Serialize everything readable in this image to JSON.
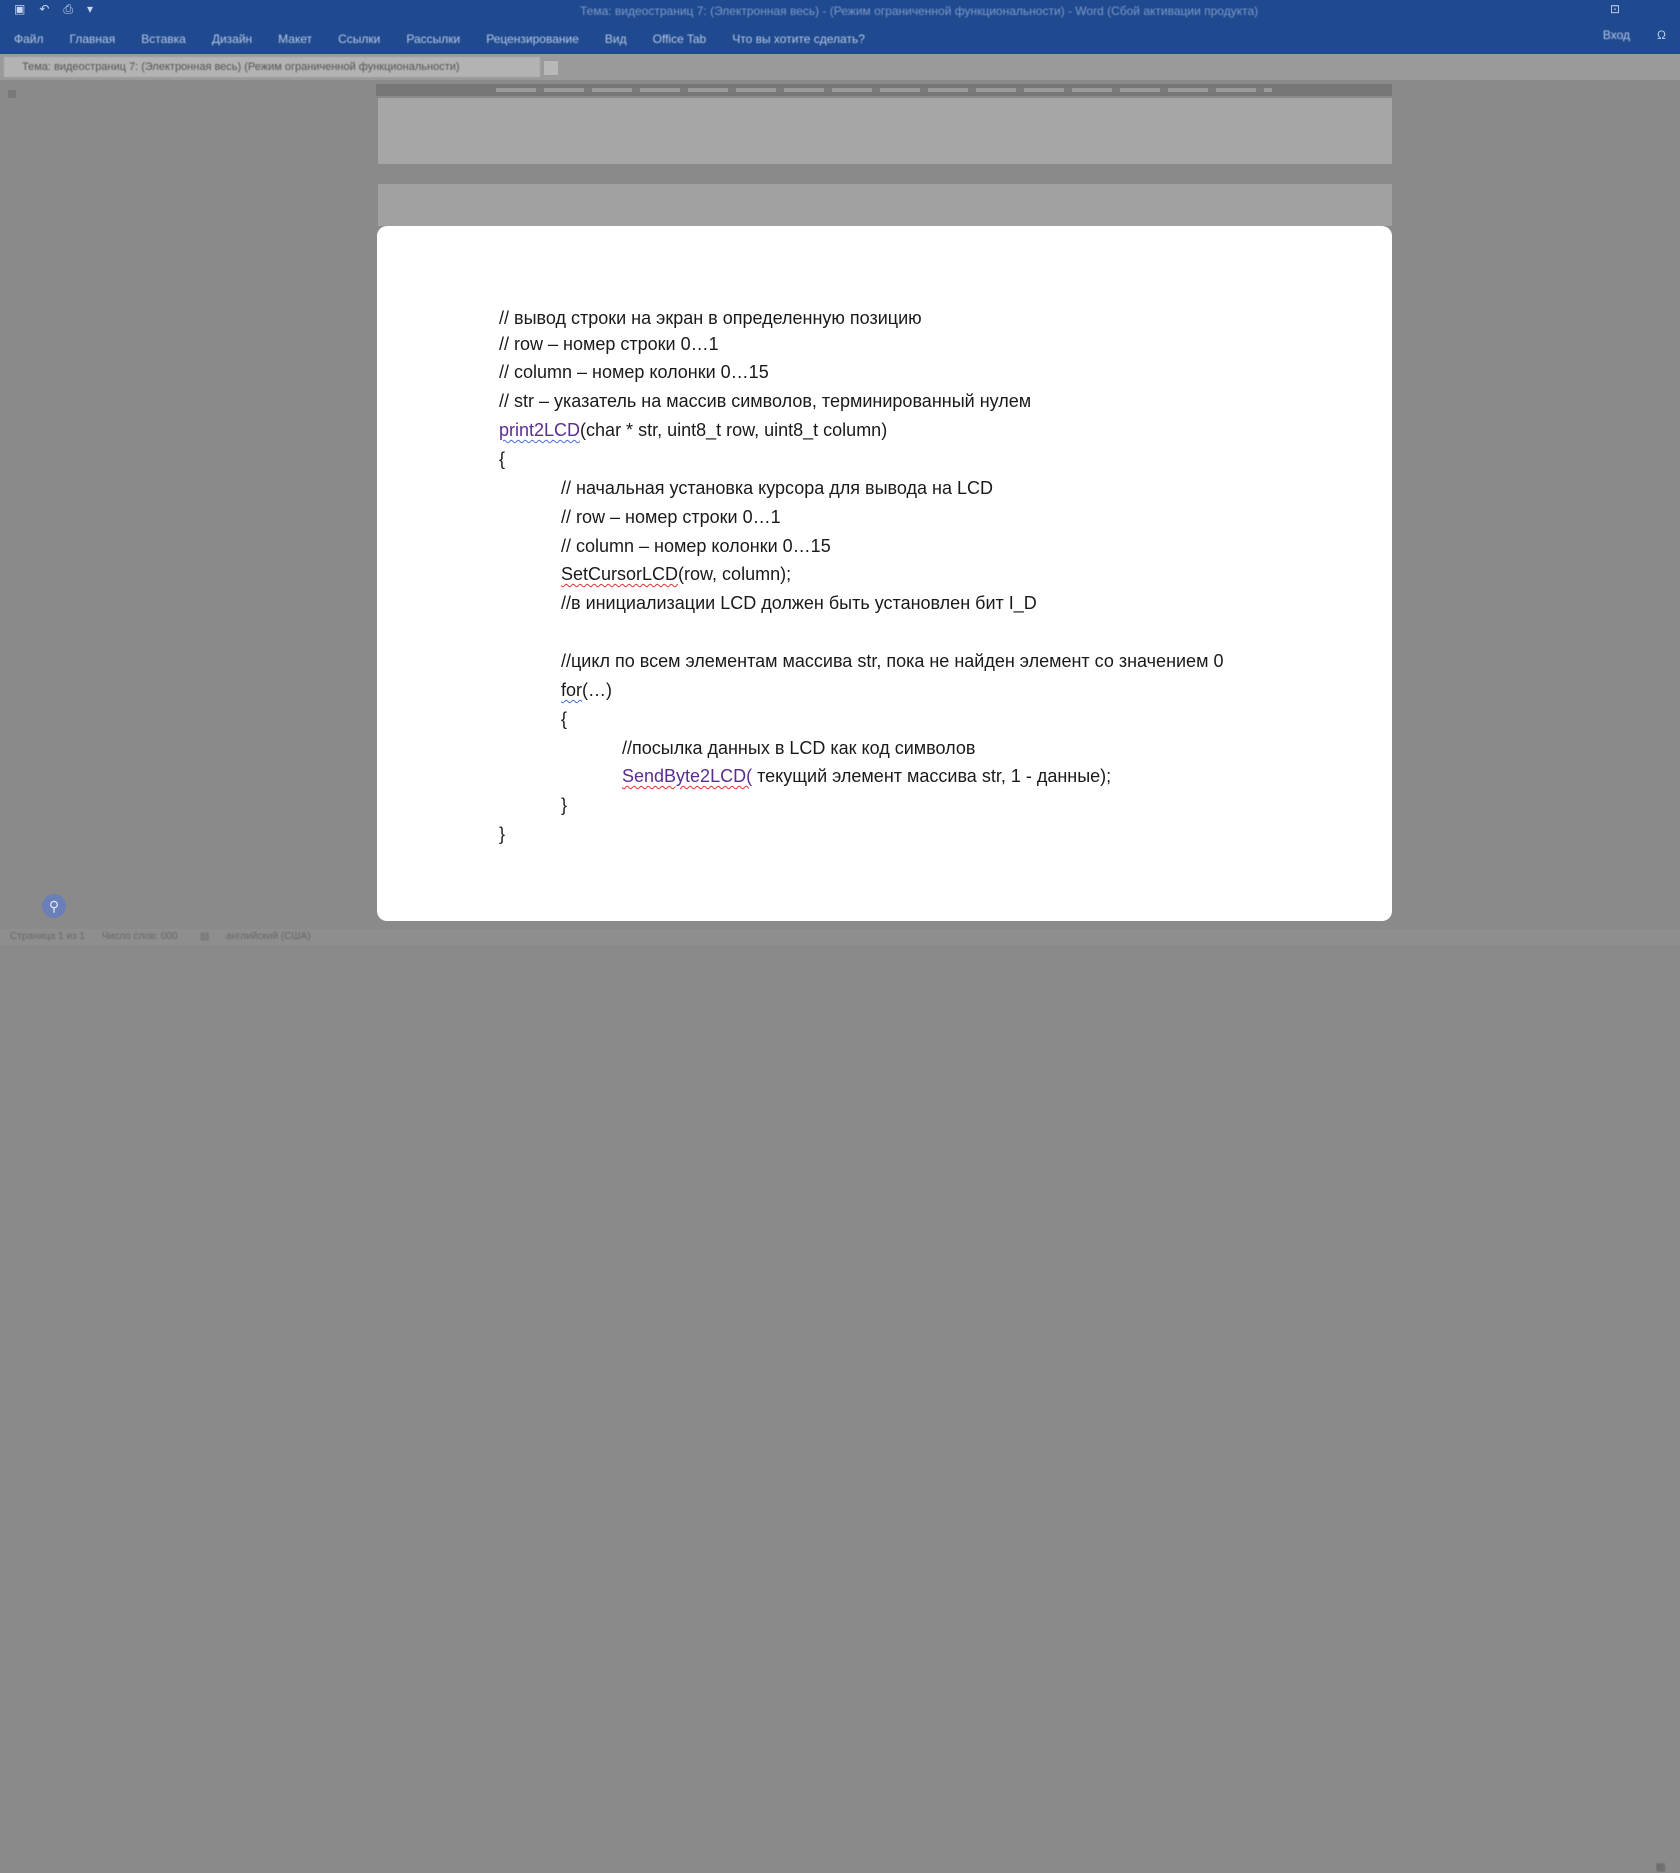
{
  "window": {
    "title": "Тема: видеостраниц 7: (Электронная весь) - (Режим ограниченной функциональности) - Word (Сбой активации продукта)",
    "qat_icons": [
      "save-icon",
      "undo-icon",
      "print-icon",
      "customize-icon"
    ]
  },
  "ribbon": {
    "tabs": [
      "Файл",
      "Главная",
      "Вставка",
      "Дизайн",
      "Макет",
      "Ссылки",
      "Рассылки",
      "Рецензирование",
      "Вид",
      "Office Tab",
      "Что вы хотите сделать?"
    ],
    "right_label": "Вход",
    "share_label": "Ω"
  },
  "document_tab": {
    "label": "Тема: видеостраниц 7: (Электронная весь) (Режим ограниченной функциональности)"
  },
  "code": {
    "lines": [
      "// вывод строки на экран в определенную позицию",
      "// row – номер строки 0…1",
      "// column – номер колонки 0…15",
      "// str – указатель на массив символов, терминированный нулем",
      "print2LCD",
      "(char * str, uint8_t row, uint8_t column)",
      "{",
      "// начальная установка курсора для вывода на LCD",
      "// row – номер строки 0…1",
      "// column – номер колонки 0…15",
      "SetCursorLCD",
      "(row, column);",
      "//в инициализации LCD должен быть установлен бит I_D",
      "//цикл по всем элементам массива str, пока не найден элемент со значением 0",
      "for",
      "(…)",
      "{",
      "//посылка данных в LCD как код символов",
      "SendByte2LCD(",
      " текущий элемент массива str, 1 - данные);",
      "}",
      "}"
    ]
  },
  "statusbar": {
    "page": "Страница 1 из 1",
    "words": "Число слов: 000",
    "lang": "английский (США)"
  }
}
